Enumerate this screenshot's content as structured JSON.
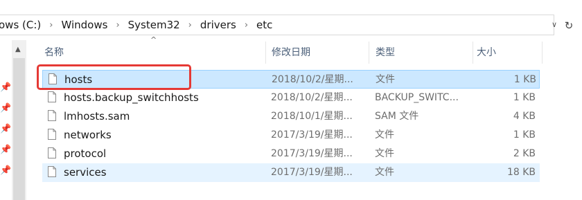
{
  "address_bar": {
    "crumbs": [
      "ows (C:)",
      "Windows",
      "System32",
      "drivers",
      "etc"
    ],
    "dropdown_icon": "chevron-down-icon",
    "refresh_icon": "refresh-icon"
  },
  "columns": {
    "name": "名称",
    "date": "修改日期",
    "type": "类型",
    "size": "大小"
  },
  "files": [
    {
      "name": "hosts",
      "date": "2018/10/2/星期...",
      "type": "文件",
      "size": "1 KB",
      "state": "selected"
    },
    {
      "name": "hosts.backup_switchhosts",
      "date": "2018/10/2/星期...",
      "type": "BACKUP_SWITC...",
      "size": "1 KB",
      "state": "normal"
    },
    {
      "name": "lmhosts.sam",
      "date": "2018/10/1/星期...",
      "type": "SAM 文件",
      "size": "4 KB",
      "state": "normal"
    },
    {
      "name": "networks",
      "date": "2017/3/19/星期...",
      "type": "文件",
      "size": "1 KB",
      "state": "normal"
    },
    {
      "name": "protocol",
      "date": "2017/3/19/星期...",
      "type": "文件",
      "size": "2 KB",
      "state": "normal"
    },
    {
      "name": "services",
      "date": "2017/3/19/星期...",
      "type": "文件",
      "size": "18 KB",
      "state": "hovered"
    }
  ],
  "colors": {
    "selected_bg": "#cce8ff",
    "hover_bg": "#e5f3ff",
    "annotation": "#e53935"
  }
}
